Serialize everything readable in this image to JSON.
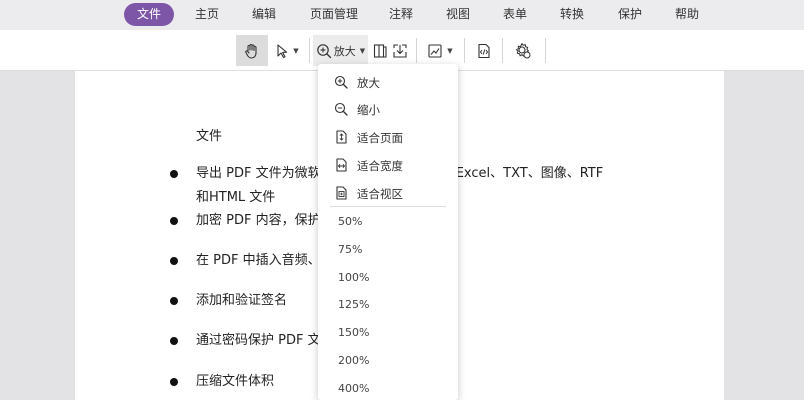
{
  "menubar": {
    "items": [
      "文件",
      "主页",
      "编辑",
      "页面管理",
      "注释",
      "视图",
      "表单",
      "转换",
      "保护",
      "帮助"
    ],
    "active": "文件"
  },
  "toolbar": {
    "zoom_label": "放大",
    "icons": [
      "hand-icon",
      "select-arrow-icon",
      "zoom-in-icon",
      "page-view-icon",
      "download-icon",
      "image-edit-icon",
      "code-icon",
      "settings-icon"
    ]
  },
  "document": {
    "title": "文件",
    "bullets": [
      "导出 PDF 文件为微软 Word、PowerPoint、Excel、TXT、图像、RTF\n和HTML 文件",
      "加密 PDF 内容，保护隐私",
      "在 PDF 中插入音频、视频",
      "添加和验证签名",
      "通过密码保护 PDF 文件",
      "压缩文件体积"
    ]
  },
  "zoom_menu": {
    "commands": [
      {
        "label": "放大",
        "icon": "zoom-in-icon"
      },
      {
        "label": "缩小",
        "icon": "zoom-out-icon"
      },
      {
        "label": "适合页面",
        "icon": "fit-page-icon"
      },
      {
        "label": "适合宽度",
        "icon": "fit-width-icon"
      },
      {
        "label": "适合视区",
        "icon": "fit-visible-icon"
      }
    ],
    "levels": [
      "50%",
      "75%",
      "100%",
      "125%",
      "150%",
      "200%",
      "400%"
    ]
  },
  "colors": {
    "accent": "#7d56a8",
    "menubar_bg": "#ececef",
    "canvas_bg": "#e3e3e6"
  }
}
